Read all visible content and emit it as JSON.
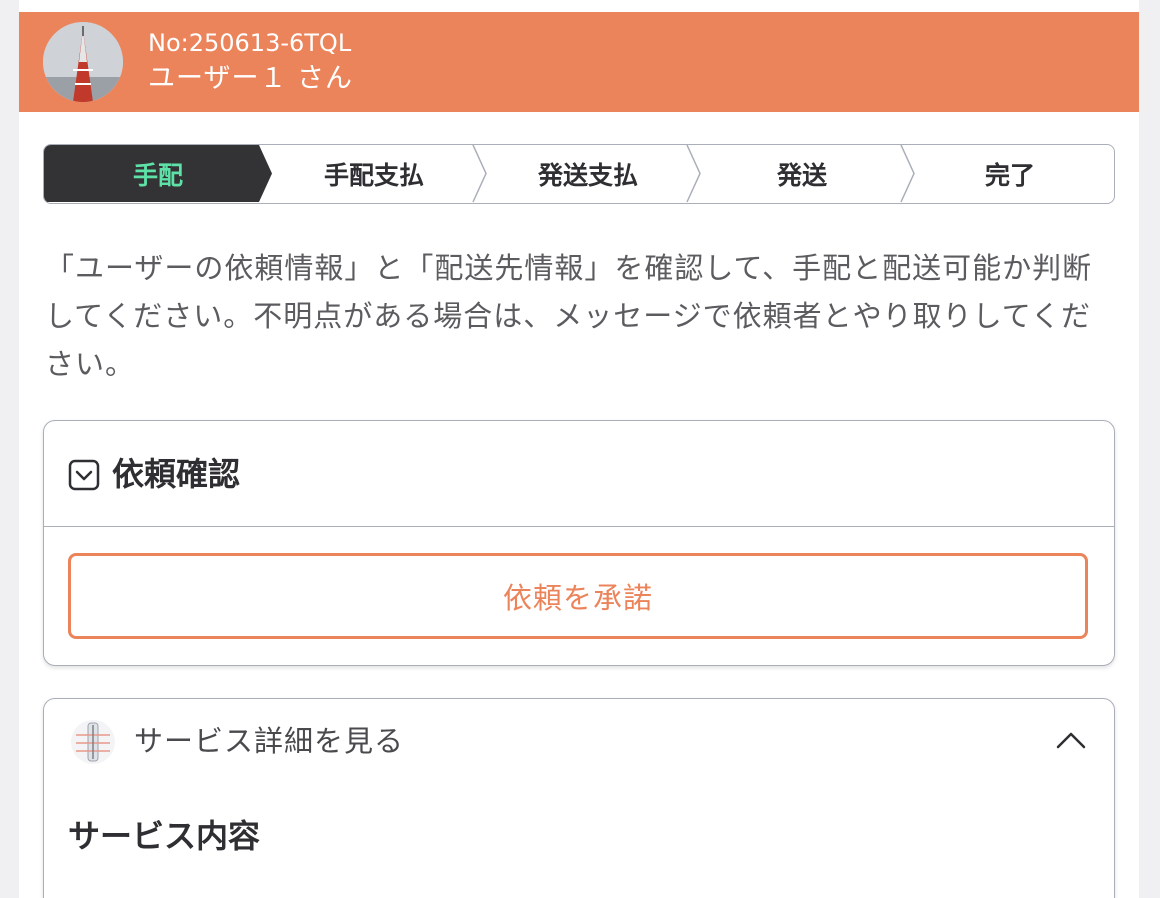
{
  "header": {
    "order_no": "No:250613-6TQL",
    "user_name": "ユーザー１ さん"
  },
  "stepper": {
    "steps": [
      {
        "label": "手配",
        "active": true
      },
      {
        "label": "手配支払",
        "active": false
      },
      {
        "label": "発送支払",
        "active": false
      },
      {
        "label": "発送",
        "active": false
      },
      {
        "label": "完了",
        "active": false
      }
    ]
  },
  "description": "「ユーザーの依頼情報」と「配送先情報」を確認して、手配と配送可能か判断してください。不明点がある場合は、メッセージで依頼者とやり取りしてください。",
  "confirm_card": {
    "title": "依頼確認",
    "accept_button": "依頼を承諾"
  },
  "service_card": {
    "toggle_label": "サービス詳細を見る",
    "content_title": "サービス内容"
  },
  "colors": {
    "accent": "#ec845b",
    "active_step_bg": "#333336",
    "active_step_text": "#5ee0a7"
  }
}
